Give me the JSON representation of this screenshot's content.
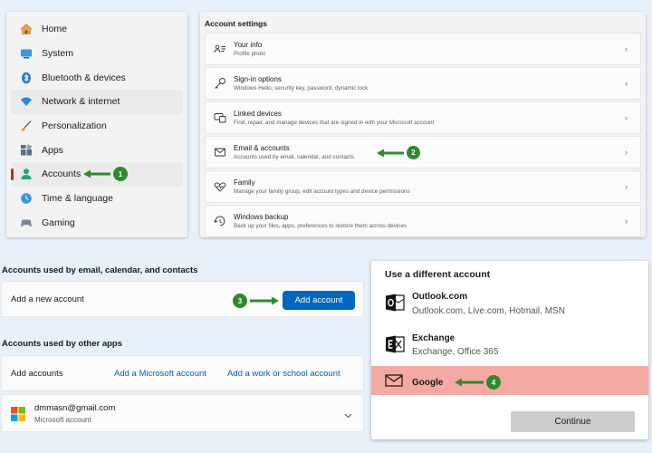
{
  "sidebar": {
    "items": [
      {
        "label": "Home"
      },
      {
        "label": "System"
      },
      {
        "label": "Bluetooth & devices"
      },
      {
        "label": "Network & internet"
      },
      {
        "label": "Personalization"
      },
      {
        "label": "Apps"
      },
      {
        "label": "Accounts"
      },
      {
        "label": "Time & language"
      },
      {
        "label": "Gaming"
      }
    ]
  },
  "account_settings": {
    "title": "Account settings",
    "rows": [
      {
        "title": "Your info",
        "subtitle": "Profile photo"
      },
      {
        "title": "Sign-in options",
        "subtitle": "Windows Hello, security key, password, dynamic lock"
      },
      {
        "title": "Linked devices",
        "subtitle": "Find, repair, and manage devices that are signed in with your Microsoft account"
      },
      {
        "title": "Email & accounts",
        "subtitle": "Accounts used by email, calendar, and contacts"
      },
      {
        "title": "Family",
        "subtitle": "Manage your family group, edit account types and device permissions"
      },
      {
        "title": "Windows backup",
        "subtitle": "Back up your files, apps, preferences to restore them across devices"
      }
    ]
  },
  "email_section": {
    "title1": "Accounts used by email, calendar, and contacts",
    "add_new_label": "Add a new account",
    "add_account_button": "Add account",
    "title2": "Accounts used by other apps",
    "add_accounts_label": "Add accounts",
    "link_microsoft": "Add a Microsoft account",
    "link_work": "Add a work or school account",
    "account": {
      "email": "dmmasn@gmail.com",
      "type": "Microsoft account"
    }
  },
  "dialog": {
    "title": "Use a different account",
    "options": [
      {
        "name": "Outlook.com",
        "desc": "Outlook.com, Live.com, Hotmail, MSN"
      },
      {
        "name": "Exchange",
        "desc": "Exchange, Office 365"
      },
      {
        "name": "Google",
        "desc": ""
      }
    ],
    "continue_button": "Continue"
  },
  "annotations": [
    "1",
    "2",
    "3",
    "4"
  ],
  "colors": {
    "accent_red": "#c42b1c",
    "primary_blue": "#0067c0",
    "annotation_green": "#2e8b2e",
    "highlight_pink": "#f4a9a3"
  }
}
